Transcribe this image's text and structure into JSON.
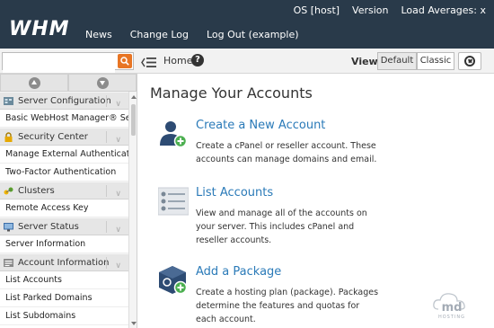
{
  "header": {
    "logo": "WHM",
    "nav": [
      "News",
      "Change Log",
      "Log Out (example)"
    ],
    "status": [
      "OS [host]",
      "Version",
      "Load Averages: x"
    ]
  },
  "toolbar": {
    "search_value": "",
    "home_label": "Home",
    "help_label": "?",
    "view_label": "View:",
    "view_default": "Default",
    "view_classic": "Classic"
  },
  "sidebar": {
    "sections": [
      {
        "category": "Server Configuration",
        "icon": "server-config-icon",
        "items": [
          "Basic WebHost Manager® Setup"
        ]
      },
      {
        "category": "Security Center",
        "icon": "lock-icon",
        "items": [
          "Manage External Authentications",
          "Two-Factor Authentication"
        ]
      },
      {
        "category": "Clusters",
        "icon": "cluster-icon",
        "items": [
          "Remote Access Key"
        ]
      },
      {
        "category": "Server Status",
        "icon": "monitor-icon",
        "items": [
          "Server Information"
        ]
      },
      {
        "category": "Account Information",
        "icon": "account-info-icon",
        "items": [
          "List Accounts",
          "List Parked Domains",
          "List Subdomains"
        ]
      }
    ]
  },
  "main": {
    "title": "Manage Your Accounts",
    "cards": [
      {
        "title": "Create a New Account",
        "desc": "Create a cPanel or reseller account. These accounts can manage domains and email.",
        "icon": "create-account-icon"
      },
      {
        "title": "List Accounts",
        "desc": "View and manage all of the accounts on your server. This includes cPanel and reseller accounts.",
        "icon": "list-accounts-icon"
      },
      {
        "title": "Add a Package",
        "desc": "Create a hosting plan (package). Packages determine the features and quotas for each account.",
        "icon": "add-package-icon"
      }
    ]
  },
  "watermark": {
    "text": "md",
    "subtext": "HOSTING"
  },
  "colors": {
    "header_bg": "#293a4a",
    "link": "#2a7ab8",
    "search_button": "#e87524",
    "badge_green": "#4caf50"
  }
}
